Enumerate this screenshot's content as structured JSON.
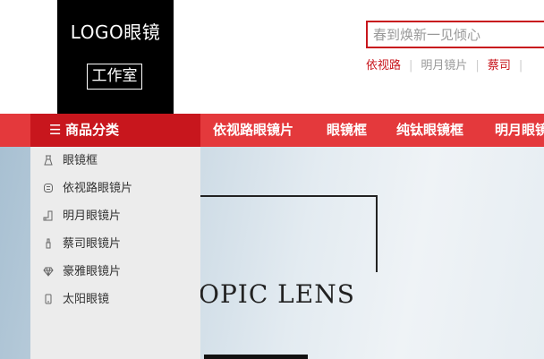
{
  "logo": {
    "title": "LOGO眼镜",
    "subtitle": "工作室"
  },
  "search": {
    "placeholder": "春到焕新一见倾心"
  },
  "hot_words": [
    {
      "label": "依视路",
      "accent": true
    },
    {
      "label": "明月镜片",
      "accent": false
    },
    {
      "label": "蔡司",
      "accent": true
    }
  ],
  "nav": {
    "category_label": "商品分类",
    "menu_icon": "list-icon",
    "items": [
      "依视路眼镜片",
      "眼镜框",
      "纯钛眼镜框",
      "明月眼镜"
    ]
  },
  "categories": [
    {
      "label": "眼镜框",
      "icon": "glasses-frame-icon"
    },
    {
      "label": "依视路眼镜片",
      "icon": "lens-icon"
    },
    {
      "label": "明月眼镜片",
      "icon": "boot-icon"
    },
    {
      "label": "蔡司眼镜片",
      "icon": "lipstick-icon"
    },
    {
      "label": "豪雅眼镜片",
      "icon": "diamond-icon"
    },
    {
      "label": "太阳眼镜",
      "icon": "phone-icon"
    }
  ],
  "banner": {
    "text": "OPIC LENS"
  },
  "colors": {
    "brand_red": "#e4393c",
    "dark_red": "#c8161d",
    "logo_bg": "#000000"
  }
}
